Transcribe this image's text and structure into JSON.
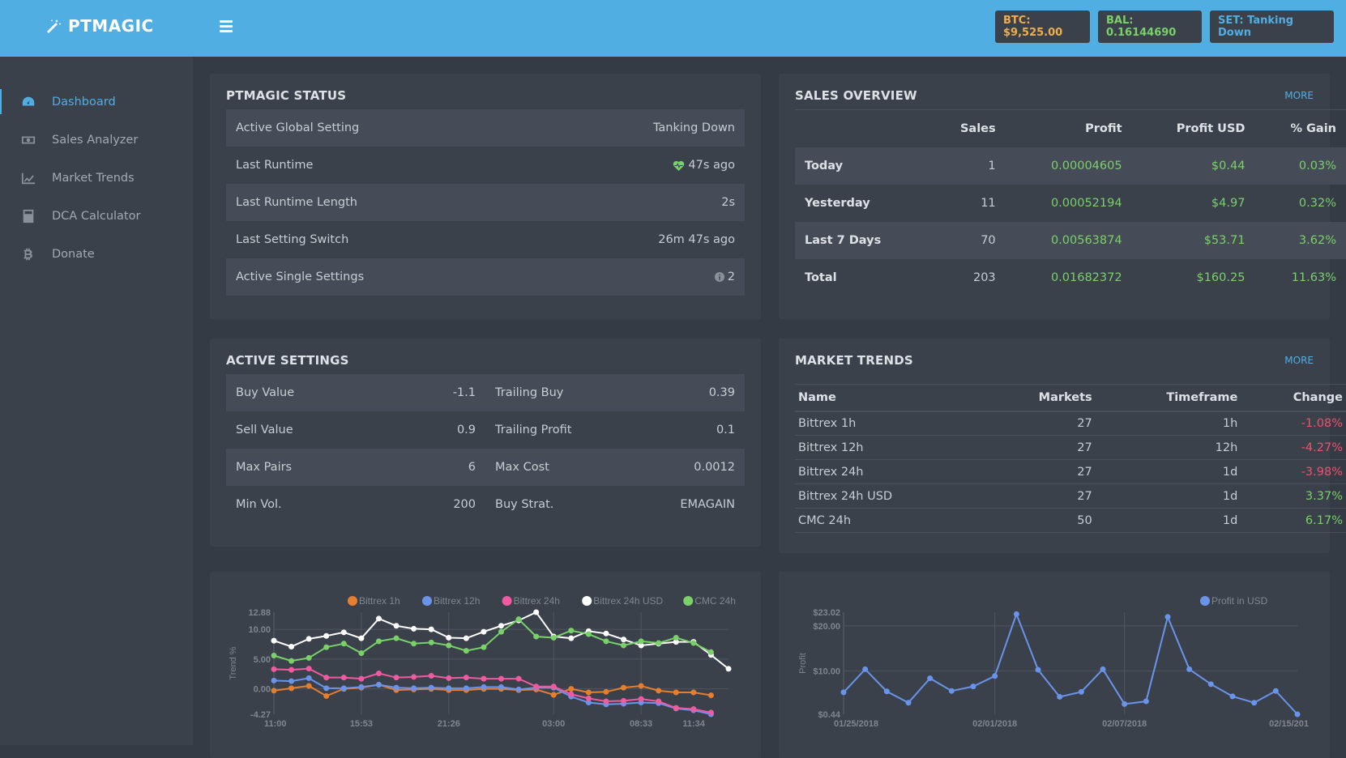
{
  "header": {
    "logo_text": "PTMAGIC",
    "badges": {
      "btc": {
        "label": "BTC: $9,525.00",
        "color": "#f0ad4e"
      },
      "bal": {
        "label": "BAL: 0.16144690",
        "color": "#7ad069"
      },
      "set": {
        "label": "SET: Tanking Down",
        "color": "#51aee3"
      }
    }
  },
  "sidebar": {
    "items": [
      {
        "label": "Dashboard",
        "icon": "dashboard-icon",
        "active": true
      },
      {
        "label": "Sales Analyzer",
        "icon": "money-icon"
      },
      {
        "label": "Market Trends",
        "icon": "chart-line-icon"
      },
      {
        "label": "DCA Calculator",
        "icon": "calculator-icon"
      },
      {
        "label": "Donate",
        "icon": "bitcoin-icon"
      }
    ]
  },
  "status": {
    "title": "PTMAGIC STATUS",
    "rows": [
      {
        "label": "Active Global Setting",
        "value": "Tanking Down"
      },
      {
        "label": "Last Runtime",
        "value": "47s ago",
        "icon": "heartbeat-icon"
      },
      {
        "label": "Last Runtime Length",
        "value": "2s"
      },
      {
        "label": "Last Setting Switch",
        "value": "26m 47s ago"
      },
      {
        "label": "Active Single Settings",
        "value": "2",
        "icon": "info-icon"
      }
    ]
  },
  "sales": {
    "title": "SALES OVERVIEW",
    "more": "MORE",
    "headers": [
      "",
      "Sales",
      "Profit",
      "Profit USD",
      "% Gain"
    ],
    "rows": [
      [
        "Today",
        "1",
        "0.00004605",
        "$0.44",
        "0.03%"
      ],
      [
        "Yesterday",
        "11",
        "0.00052194",
        "$4.97",
        "0.32%"
      ],
      [
        "Last 7 Days",
        "70",
        "0.00563874",
        "$53.71",
        "3.62%"
      ],
      [
        "Total",
        "203",
        "0.01682372",
        "$160.25",
        "11.63%"
      ]
    ]
  },
  "active_settings": {
    "title": "ACTIVE SETTINGS",
    "rows": [
      [
        {
          "label": "Buy Value",
          "value": "-1.1"
        },
        {
          "label": "Trailing Buy",
          "value": "0.39"
        }
      ],
      [
        {
          "label": "Sell Value",
          "value": "0.9"
        },
        {
          "label": "Trailing Profit",
          "value": "0.1"
        }
      ],
      [
        {
          "label": "Max Pairs",
          "value": "6"
        },
        {
          "label": "Max Cost",
          "value": "0.0012"
        }
      ],
      [
        {
          "label": "Min Vol.",
          "value": "200"
        },
        {
          "label": "Buy Strat.",
          "value": "EMAGAIN"
        }
      ]
    ]
  },
  "market_trends": {
    "title": "MARKET TRENDS",
    "more": "MORE",
    "headers": [
      "Name",
      "Markets",
      "Timeframe",
      "Change"
    ],
    "rows": [
      {
        "name": "Bittrex 1h",
        "markets": "27",
        "timeframe": "1h",
        "change": "-1.08%",
        "negative": true
      },
      {
        "name": "Bittrex 12h",
        "markets": "27",
        "timeframe": "12h",
        "change": "-4.27%",
        "negative": true
      },
      {
        "name": "Bittrex 24h",
        "markets": "27",
        "timeframe": "1d",
        "change": "-3.98%",
        "negative": true
      },
      {
        "name": "Bittrex 24h USD",
        "markets": "27",
        "timeframe": "1d",
        "change": "3.37%",
        "negative": false
      },
      {
        "name": "CMC 24h",
        "markets": "50",
        "timeframe": "1d",
        "change": "6.17%",
        "negative": false
      }
    ]
  },
  "chart_data": [
    {
      "type": "line",
      "title": "",
      "xlabel": "",
      "ylabel": "Trend %",
      "ylim": [
        -4.27,
        12.88
      ],
      "yticks": [
        "12.88",
        "10.00",
        "5.00",
        "0.00",
        "-4.27"
      ],
      "ytick_values": [
        12.88,
        10,
        5,
        0,
        -4.27
      ],
      "xticks": [
        "11:00",
        "15:53",
        "21:26",
        "03:00",
        "08:33",
        "11:34"
      ],
      "xtick_index": [
        0,
        5,
        10,
        16,
        21,
        24
      ],
      "grid": true,
      "legend": "top",
      "series": [
        {
          "name": "Bittrex 1h",
          "color": "#e67e30",
          "values": [
            -0.3,
            0.1,
            0.5,
            -1.2,
            0.0,
            0.2,
            0.7,
            -0.2,
            -0.1,
            0.0,
            -0.2,
            -0.2,
            0.0,
            0.0,
            -0.2,
            -0.1,
            -1.0,
            0.0,
            -0.6,
            -0.5,
            0.2,
            0.5,
            -0.3,
            -0.6,
            -0.6,
            -1.08
          ]
        },
        {
          "name": "Bittrex 12h",
          "color": "#6a93ea",
          "values": [
            1.4,
            1.3,
            1.8,
            0.1,
            0.1,
            0.3,
            0.7,
            0.2,
            0.1,
            0.2,
            0.1,
            0.1,
            0.3,
            0.3,
            -0.1,
            0.2,
            0.2,
            -1.3,
            -2.3,
            -2.6,
            -2.5,
            -2.3,
            -2.4,
            -3.3,
            -3.6,
            -4.27
          ]
        },
        {
          "name": "Bittrex 24h",
          "color": "#ef5aa1",
          "values": [
            3.3,
            3.2,
            3.4,
            1.9,
            1.9,
            1.7,
            2.6,
            1.9,
            2.0,
            2.2,
            1.8,
            1.9,
            1.7,
            1.7,
            1.7,
            0.4,
            0.4,
            -0.9,
            -1.6,
            -2.1,
            -2.0,
            -1.7,
            -2.1,
            -3.2,
            -3.4,
            -3.98
          ]
        },
        {
          "name": "Bittrex 24h USD",
          "color": "#ffffff",
          "values": [
            8.1,
            7.1,
            8.4,
            8.9,
            9.5,
            8.5,
            11.8,
            10.6,
            10.1,
            10.0,
            8.6,
            8.5,
            9.6,
            10.6,
            11.5,
            12.88,
            8.8,
            8.5,
            9.7,
            9.3,
            8.3,
            7.3,
            7.6,
            7.9,
            7.9,
            5.7,
            3.37
          ]
        },
        {
          "name": "CMC 24h",
          "color": "#7ad069",
          "values": [
            5.6,
            4.7,
            5.2,
            7.0,
            7.6,
            6.0,
            8.0,
            8.5,
            7.6,
            7.8,
            7.3,
            6.4,
            7.0,
            9.6,
            11.7,
            8.8,
            8.6,
            9.8,
            9.2,
            8.0,
            7.3,
            8.0,
            7.7,
            8.6,
            7.7,
            6.17
          ]
        }
      ]
    },
    {
      "type": "line",
      "title": "",
      "xlabel": "",
      "ylabel": "Profit",
      "ylim": [
        0.44,
        23.02
      ],
      "yticks": [
        "$23.02",
        "$20.00",
        "$10.00",
        "$0.44"
      ],
      "ytick_values": [
        23.02,
        20,
        10,
        0.44
      ],
      "xticks": [
        "01/25/2018",
        "02/01/2018",
        "02/07/2018",
        "02/15/201"
      ],
      "xtick_index": [
        0,
        7,
        13,
        21
      ],
      "grid": true,
      "legend": "top-right",
      "series": [
        {
          "name": "Profit in USD",
          "color": "#6a93ea",
          "values": [
            5.3,
            10.4,
            5.5,
            3.0,
            8.4,
            5.6,
            6.6,
            8.9,
            22.6,
            10.3,
            4.3,
            5.4,
            10.4,
            2.7,
            3.3,
            22.0,
            10.4,
            7.1,
            4.4,
            3.0,
            5.6,
            0.44
          ]
        }
      ]
    }
  ]
}
